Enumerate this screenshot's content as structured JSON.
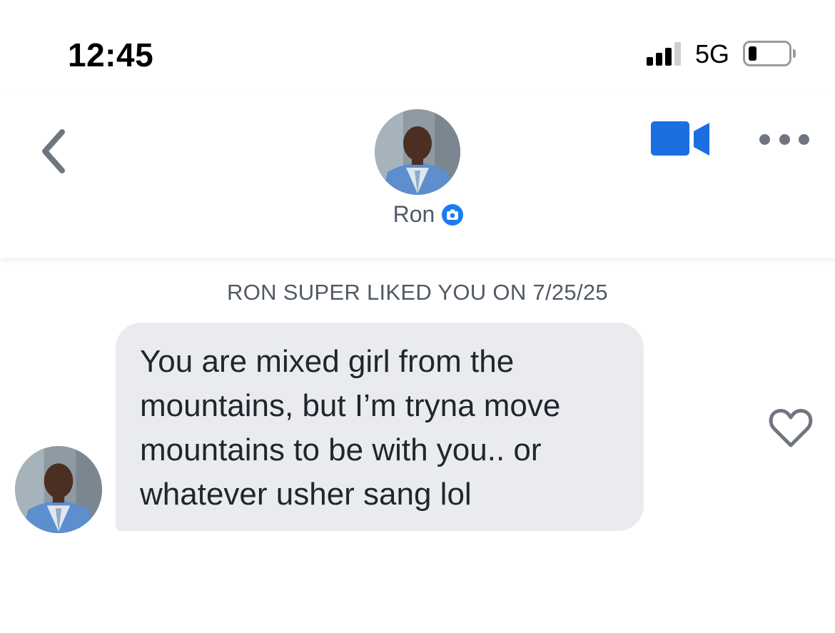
{
  "status_bar": {
    "time": "12:45",
    "network": "5G",
    "icons": [
      "signal-icon",
      "battery-icon"
    ]
  },
  "header": {
    "contact_name": "Ron",
    "icons": [
      "back-chevron-icon",
      "avatar",
      "camera-verified-icon",
      "video-camera-icon",
      "more-dots-icon"
    ],
    "accent_color": "#1b6fe0"
  },
  "conversation": {
    "notice": "RON SUPER LIKED YOU ON 7/25/25",
    "messages": [
      {
        "text": "You are mixed girl from the\nmountains, but I’m tryna move\nmountains to be with you.. or\nwhatever usher sang lol",
        "liked": false
      }
    ],
    "like_icon": "heart-outline-icon"
  }
}
